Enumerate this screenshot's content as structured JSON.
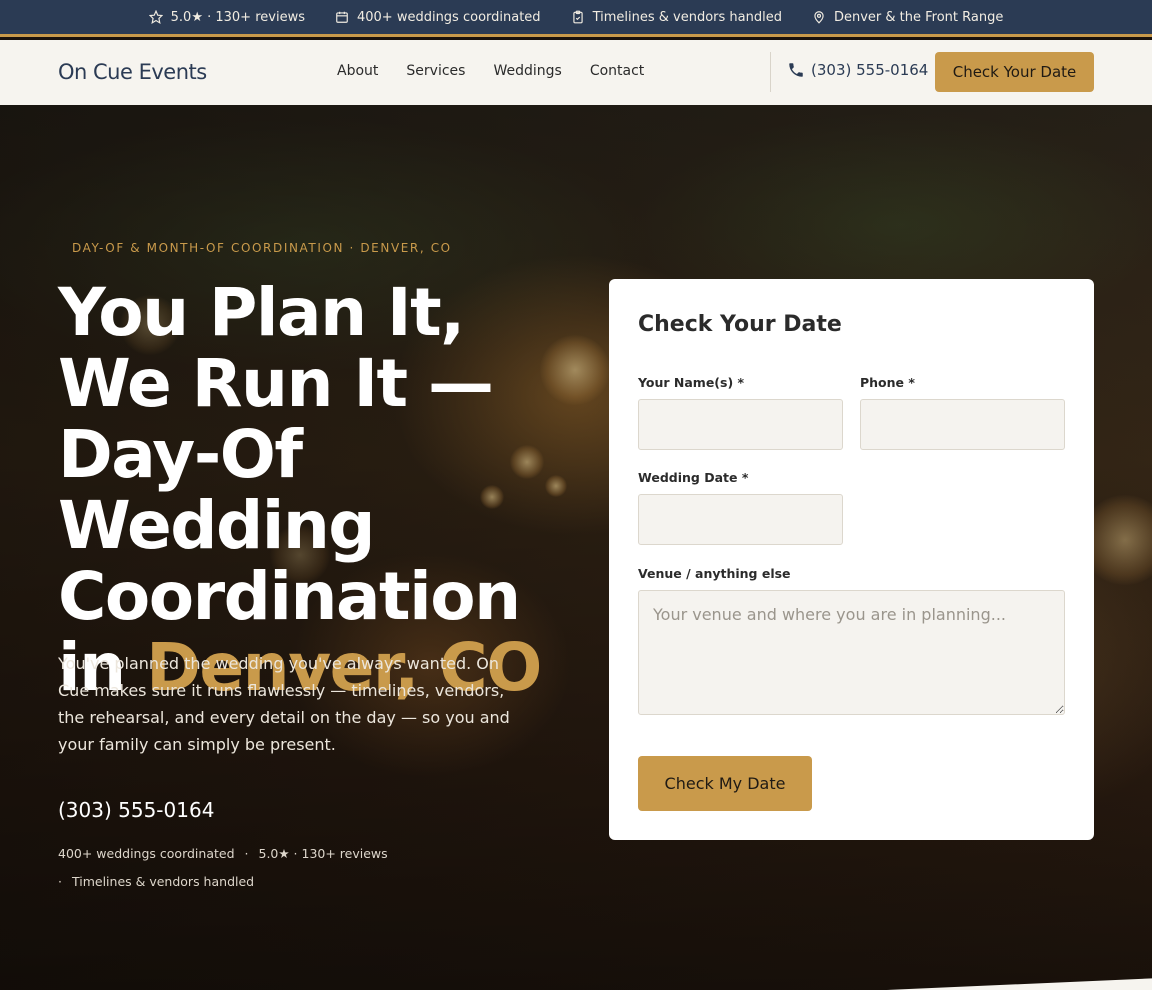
{
  "topbar": {
    "items": [
      {
        "icon": "star-icon",
        "text": "5.0★ · 130+ reviews"
      },
      {
        "icon": "calendar-icon",
        "text": "400+ weddings coordinated"
      },
      {
        "icon": "clipboard-check-icon",
        "text": "Timelines & vendors handled"
      },
      {
        "icon": "map-pin-icon",
        "text": "Denver & the Front Range"
      }
    ]
  },
  "nav": {
    "logo": "On Cue Events",
    "links": [
      "About",
      "Services",
      "Weddings",
      "Contact"
    ],
    "phone": "(303) 555-0164",
    "cta": "Check Your Date"
  },
  "hero": {
    "eyebrow": "DAY-OF & MONTH-OF COORDINATION · DENVER, CO",
    "headline_main": "You Plan It, We Run It — Day-Of Wedding Coordination in ",
    "headline_accent": "Denver, CO",
    "description": "You've planned the wedding you've always wanted. On Cue makes sure it runs flawlessly — timelines, vendors, the rehearsal, and every detail on the day — so you and your family can simply be present.",
    "phone": "(303) 555-0164",
    "stats": [
      "400+ weddings coordinated",
      "5.0★ · 130+ reviews",
      "Timelines & vendors handled"
    ],
    "separator": "·"
  },
  "form": {
    "title": "Check Your Date",
    "name_label": "Your Name(s) *",
    "name_value": "",
    "phone_label": "Phone *",
    "phone_value": "",
    "date_label": "Wedding Date *",
    "date_value": "",
    "notes_label": "Venue / anything else",
    "notes_placeholder": "Your venue and where you are in planning...",
    "submit": "Check My Date"
  },
  "colors": {
    "navy": "#2b3b54",
    "gold": "#c99a4b",
    "cream": "#f6f4ef"
  }
}
